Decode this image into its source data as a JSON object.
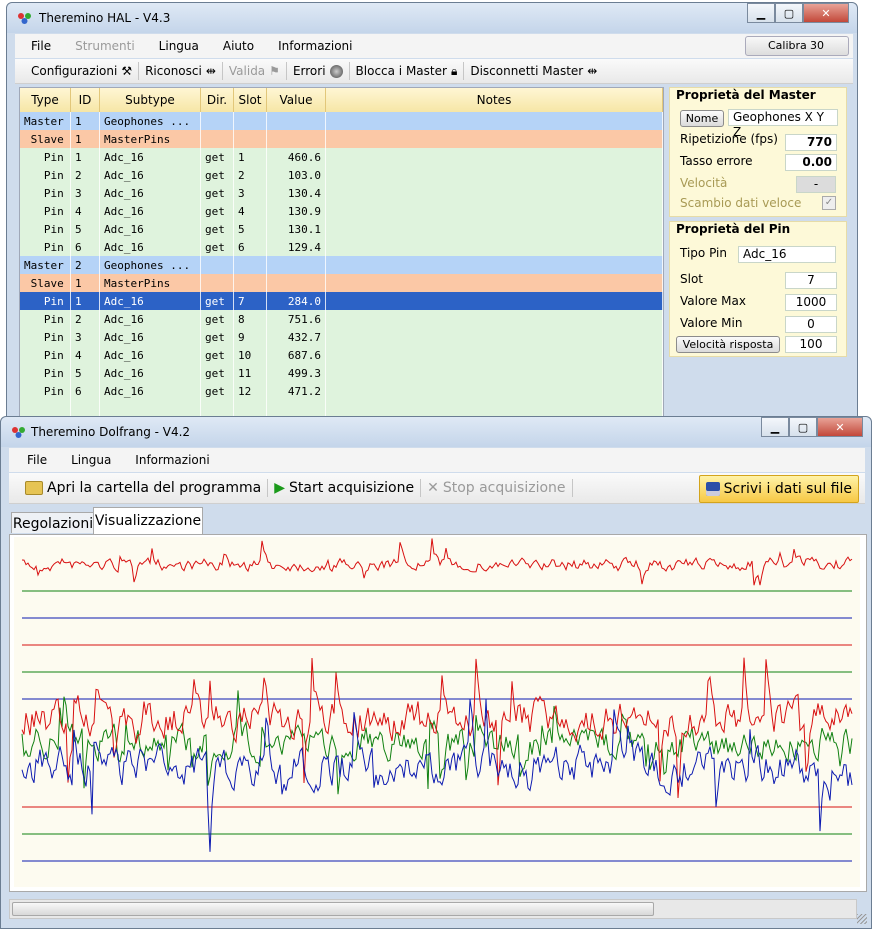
{
  "hal": {
    "title": "Theremino HAL - V4.3",
    "menu": [
      "File",
      "Strumenti",
      "Lingua",
      "Aiuto",
      "Informazioni"
    ],
    "calibra_label": "Calibra",
    "calibra_value": "30",
    "toolbar": {
      "configurazioni": "Configurazioni",
      "riconosci": "Riconosci",
      "valida": "Valida",
      "errori": "Errori",
      "blocca": "Blocca i Master",
      "disconnetti": "Disconnetti Master"
    },
    "columns": [
      "Type",
      "ID",
      "Subtype",
      "Dir.",
      "Slot",
      "Value",
      "Notes"
    ],
    "rows": [
      {
        "type": "Master",
        "id": "1",
        "subtype": "Geophones ...",
        "dir": "",
        "slot": "",
        "value": "",
        "kind": "master"
      },
      {
        "type": " Slave",
        "id": "1",
        "subtype": "MasterPins",
        "dir": "",
        "slot": "",
        "value": "",
        "kind": "slave"
      },
      {
        "type": "   Pin",
        "id": "1",
        "subtype": "Adc_16",
        "dir": "get",
        "slot": "1",
        "value": "460.6",
        "kind": "pin"
      },
      {
        "type": "   Pin",
        "id": "2",
        "subtype": "Adc_16",
        "dir": "get",
        "slot": "2",
        "value": "103.0",
        "kind": "pin"
      },
      {
        "type": "   Pin",
        "id": "3",
        "subtype": "Adc_16",
        "dir": "get",
        "slot": "3",
        "value": "130.4",
        "kind": "pin"
      },
      {
        "type": "   Pin",
        "id": "4",
        "subtype": "Adc_16",
        "dir": "get",
        "slot": "4",
        "value": "130.9",
        "kind": "pin"
      },
      {
        "type": "   Pin",
        "id": "5",
        "subtype": "Adc_16",
        "dir": "get",
        "slot": "5",
        "value": "130.1",
        "kind": "pin"
      },
      {
        "type": "   Pin",
        "id": "6",
        "subtype": "Adc_16",
        "dir": "get",
        "slot": "6",
        "value": "129.4",
        "kind": "pin"
      },
      {
        "type": "Master",
        "id": "2",
        "subtype": "Geophones ...",
        "dir": "",
        "slot": "",
        "value": "",
        "kind": "master"
      },
      {
        "type": " Slave",
        "id": "1",
        "subtype": "MasterPins",
        "dir": "",
        "slot": "",
        "value": "",
        "kind": "slave"
      },
      {
        "type": "   Pin",
        "id": "1",
        "subtype": "Adc_16",
        "dir": "get",
        "slot": "7",
        "value": "284.0",
        "kind": "selected"
      },
      {
        "type": "   Pin",
        "id": "2",
        "subtype": "Adc_16",
        "dir": "get",
        "slot": "8",
        "value": "751.6",
        "kind": "pin"
      },
      {
        "type": "   Pin",
        "id": "3",
        "subtype": "Adc_16",
        "dir": "get",
        "slot": "9",
        "value": "432.7",
        "kind": "pin"
      },
      {
        "type": "   Pin",
        "id": "4",
        "subtype": "Adc_16",
        "dir": "get",
        "slot": "10",
        "value": "687.6",
        "kind": "pin"
      },
      {
        "type": "   Pin",
        "id": "5",
        "subtype": "Adc_16",
        "dir": "get",
        "slot": "11",
        "value": "499.3",
        "kind": "pin"
      },
      {
        "type": "   Pin",
        "id": "6",
        "subtype": "Adc_16",
        "dir": "get",
        "slot": "12",
        "value": "471.2",
        "kind": "pin"
      }
    ],
    "master_props": {
      "heading": "Proprietà del Master",
      "nome_btn": "Nome",
      "nome_val": "Geophones X Y Z",
      "ripetizione_label": "Ripetizione (fps)",
      "ripetizione_val": "770",
      "tasso_label": "Tasso errore",
      "tasso_val": "0.00",
      "velocita_label": "Velocità",
      "velocita_val": "-",
      "scambio_label": "Scambio dati veloce",
      "scambio_checked": "✓"
    },
    "pin_props": {
      "heading": "Proprietà del Pin",
      "tipo_label": "Tipo Pin",
      "tipo_val": "Adc_16",
      "slot_label": "Slot",
      "slot_val": "7",
      "max_label": "Valore Max",
      "max_val": "1000",
      "min_label": "Valore Min",
      "min_val": "0",
      "risposta_btn": "Velocità risposta",
      "risposta_val": "100"
    }
  },
  "dolfrang": {
    "title": "Theremino Dolfrang - V4.2",
    "menu": [
      "File",
      "Lingua",
      "Informazioni"
    ],
    "toolbar": {
      "apri": "Apri la cartella del programma",
      "start": "Start acquisizione",
      "stop": "Stop acquisizione",
      "scrivi": "Scrivi i dati sul file"
    },
    "tabs": [
      "Regolazioni",
      "Visualizzazione"
    ],
    "colors": {
      "red": "#d81010",
      "green": "#108010",
      "blue": "#0c1ab0",
      "plot_bg": "#fdfbf0"
    }
  }
}
